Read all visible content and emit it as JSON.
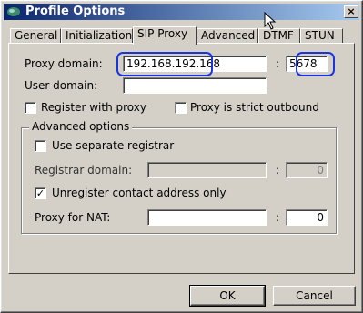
{
  "window": {
    "title": "Profile Options",
    "close_label": "×"
  },
  "tabs": [
    {
      "label": "General"
    },
    {
      "label": "Initialization"
    },
    {
      "label": "SIP Proxy"
    },
    {
      "label": "Advanced"
    },
    {
      "label": "DTMF"
    },
    {
      "label": "STUN"
    }
  ],
  "active_tab": "SIP Proxy",
  "proxy": {
    "domain_label": "Proxy domain:",
    "domain_value": "192.168.192.168",
    "port_separator": ":",
    "port_value": "5678",
    "user_domain_label": "User domain:",
    "user_domain_value": "",
    "register_label": "Register with proxy",
    "register_checked": false,
    "strict_outbound_label": "Proxy is strict outbound",
    "strict_outbound_checked": false
  },
  "advanced": {
    "group_title": "Advanced options",
    "separate_registrar_label": "Use separate registrar",
    "separate_registrar_checked": false,
    "registrar_domain_label": "Registrar domain:",
    "registrar_domain_value": "",
    "registrar_port_value": "0",
    "unregister_label": "Unregister contact address only",
    "unregister_checked": true,
    "nat_label": "Proxy for NAT:",
    "nat_value": "",
    "nat_port_value": "0"
  },
  "buttons": {
    "ok": "OK",
    "cancel": "Cancel"
  },
  "colors": {
    "titlebar_start": "#0a246a",
    "titlebar_end": "#a6caf0",
    "annotation_circle": "#1a35e0"
  }
}
